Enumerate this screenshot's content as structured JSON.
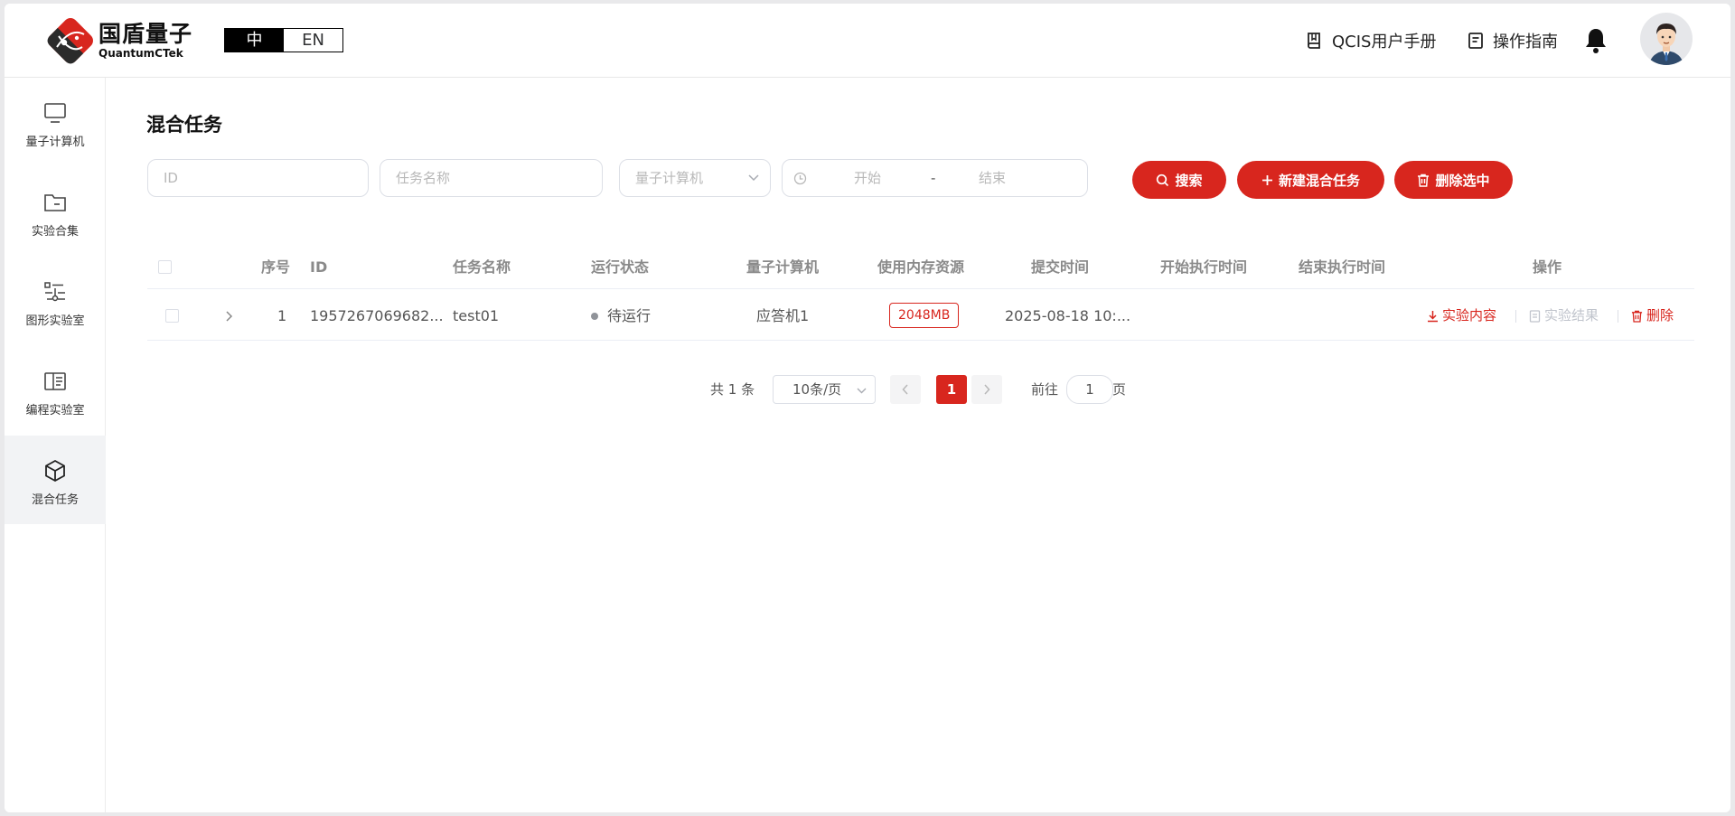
{
  "header": {
    "logo_cn": "国盾量子",
    "logo_en": "QuantumCTek",
    "lang_options": [
      "中",
      "EN"
    ],
    "manual_link": "QCIS用户手册",
    "guide_link": "操作指南"
  },
  "sidebar": {
    "items": [
      {
        "label": "量子计算机",
        "icon": "monitor-icon"
      },
      {
        "label": "实验合集",
        "icon": "folder-icon"
      },
      {
        "label": "图形实验室",
        "icon": "circuit-icon"
      },
      {
        "label": "编程实验室",
        "icon": "book-icon"
      },
      {
        "label": "混合任务",
        "icon": "cube-icon",
        "active": true
      }
    ]
  },
  "main": {
    "title": "混合任务",
    "filters": {
      "id_placeholder": "ID",
      "name_placeholder": "任务名称",
      "computer_placeholder": "量子计算机",
      "start_placeholder": "开始",
      "range_sep": "-",
      "end_placeholder": "结束"
    },
    "buttons": {
      "search": "搜索",
      "new_task": "新建混合任务",
      "delete_selected": "删除选中"
    },
    "table": {
      "columns": [
        "序号",
        "ID",
        "任务名称",
        "运行状态",
        "量子计算机",
        "使用内存资源",
        "提交时间",
        "开始执行时间",
        "结束执行时间",
        "操作"
      ],
      "rows": [
        {
          "index": "1",
          "id": "1957267069682...",
          "name": "test01",
          "status": "待运行",
          "computer": "应答机1",
          "memory": "2048MB",
          "submit_time": "2025-08-18 10:...",
          "start_time": "",
          "end_time": "",
          "actions": {
            "content": "实验内容",
            "result": "实验结果",
            "delete": "删除"
          }
        }
      ]
    },
    "pagination": {
      "total": "共 1 条",
      "page_size": "10条/页",
      "current_page": "1",
      "goto_label": "前往",
      "goto_value": "1",
      "page_suffix": "页"
    }
  },
  "colors": {
    "accent": "#d8261e",
    "muted": "#909399"
  }
}
